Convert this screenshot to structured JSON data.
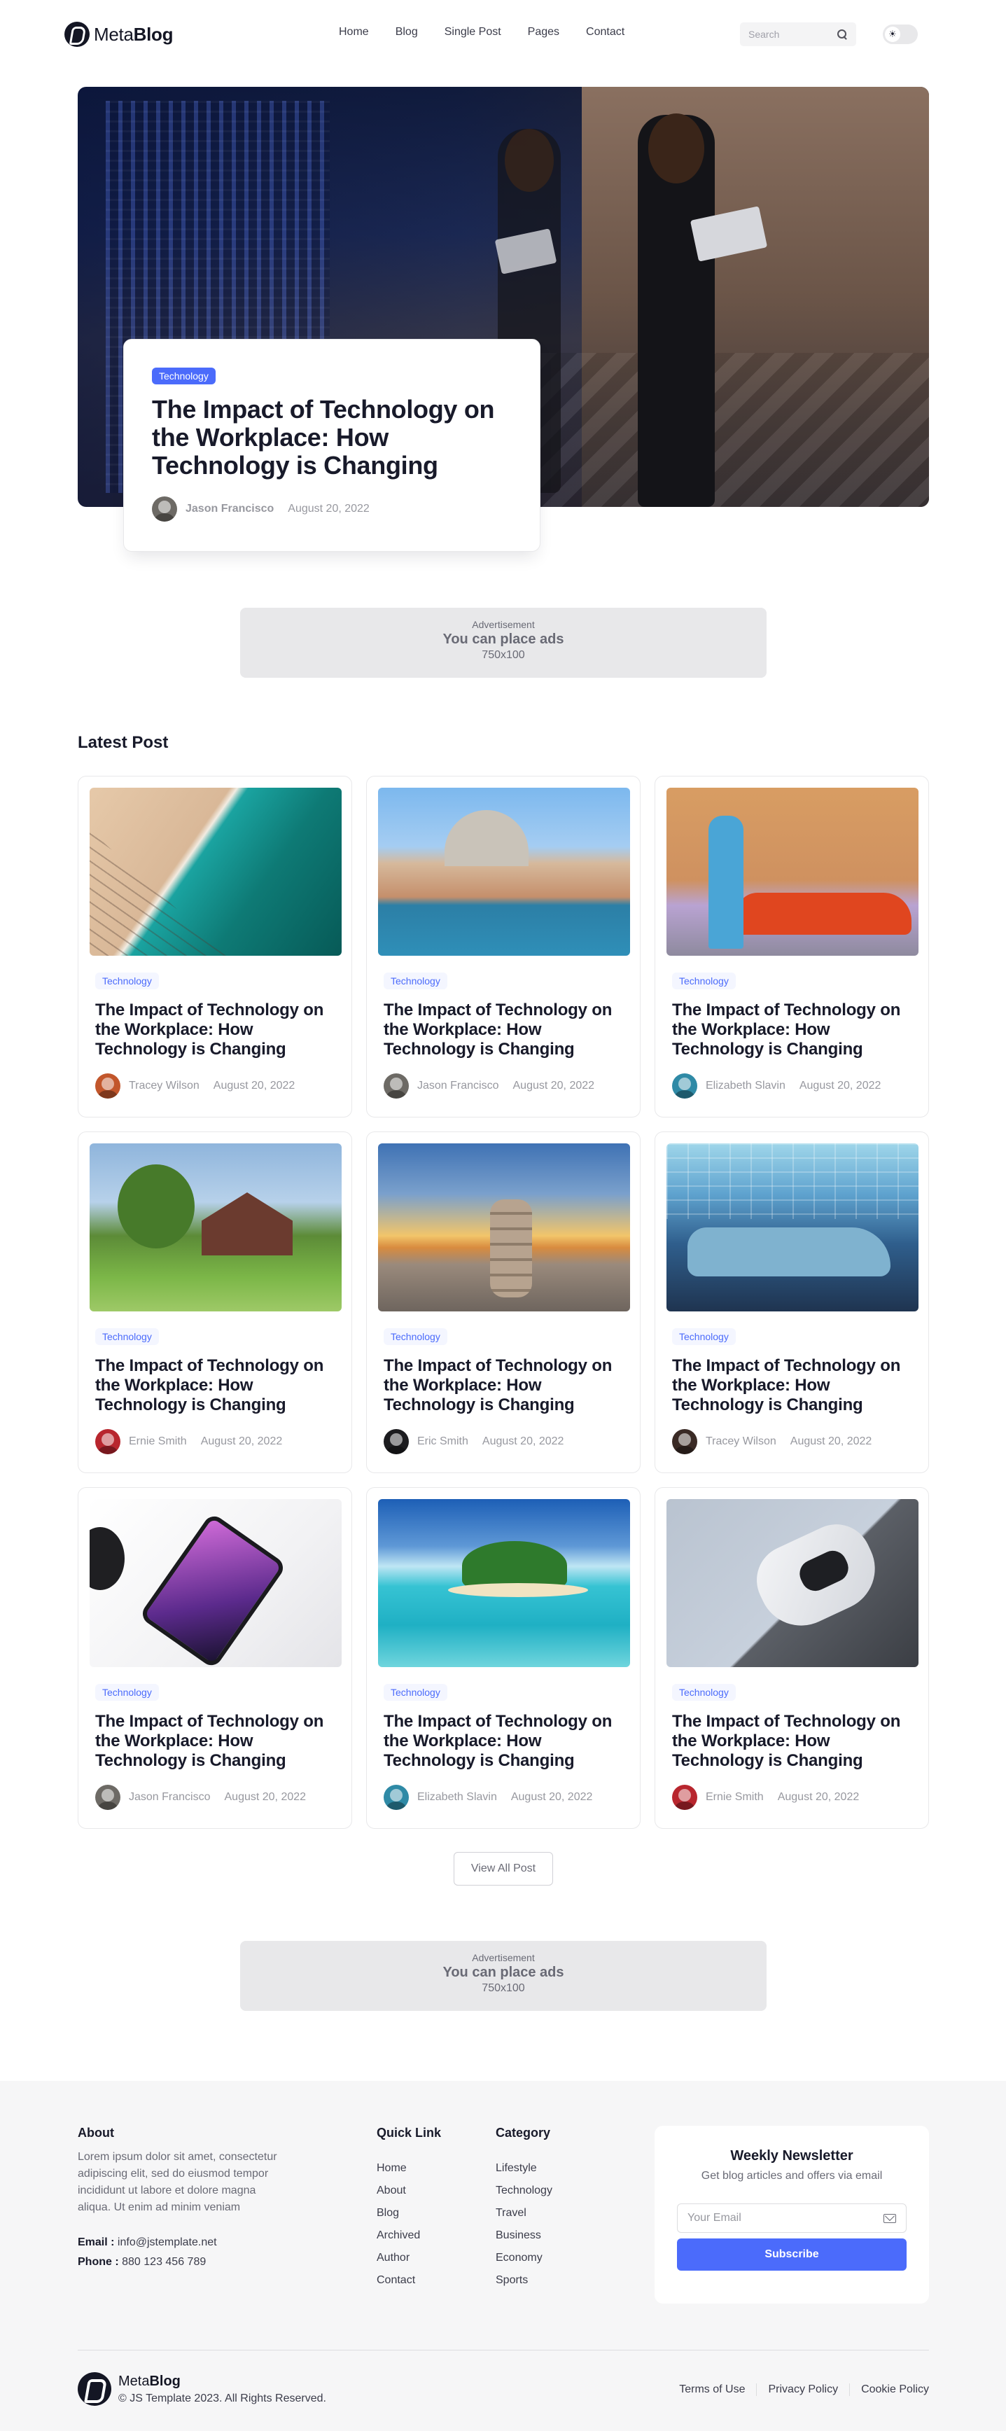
{
  "brand": {
    "name_light": "Meta",
    "name_bold": "Blog"
  },
  "nav": {
    "items": [
      "Home",
      "Blog",
      "Single Post",
      "Pages",
      "Contact"
    ]
  },
  "search": {
    "placeholder": "Search"
  },
  "theme_toggle": {
    "icon": "sun-icon",
    "glyph": "☀",
    "state": "light"
  },
  "hero": {
    "badge": "Technology",
    "title": "The Impact of Technology on the Workplace: How Technology is Changing",
    "author": "Jason Francisco",
    "date": "August 20, 2022"
  },
  "ads": [
    {
      "label": "Advertisement",
      "text": "You can place ads",
      "size": "750x100"
    },
    {
      "label": "Advertisement",
      "text": "You can place ads",
      "size": "750x100"
    }
  ],
  "latest": {
    "title": "Latest Post",
    "posts": [
      {
        "badge": "Technology",
        "title": "The Impact of Technology on the Workplace: How Technology is Changing",
        "author": "Tracey Wilson",
        "date": "August 20, 2022",
        "image": "beach-aerial",
        "avatar_color": "#c2562b"
      },
      {
        "badge": "Technology",
        "title": "The Impact of Technology on the Workplace: How Technology is Changing",
        "author": "Jason Francisco",
        "date": "August 20, 2022",
        "image": "venice-canal",
        "avatar_color": "#6d6a65"
      },
      {
        "badge": "Technology",
        "title": "The Impact of Technology on the Workplace: How Technology is Changing",
        "author": "Elizabeth Slavin",
        "date": "August 20, 2022",
        "image": "woman-red-car",
        "avatar_color": "#2f8aa6"
      },
      {
        "badge": "Technology",
        "title": "The Impact of Technology on the Workplace: How Technology is Changing",
        "author": "Ernie Smith",
        "date": "August 20, 2022",
        "image": "country-house",
        "avatar_color": "#b8262e"
      },
      {
        "badge": "Technology",
        "title": "The Impact of Technology on the Workplace: How Technology is Changing",
        "author": "Eric Smith",
        "date": "August 20, 2022",
        "image": "stacked-rocks-sunset",
        "avatar_color": "#1c1c1f"
      },
      {
        "badge": "Technology",
        "title": "The Impact of Technology on the Workplace: How Technology is Changing",
        "author": "Tracey Wilson",
        "date": "August 20, 2022",
        "image": "classic-blue-car",
        "avatar_color": "#3a2a25"
      },
      {
        "badge": "Technology",
        "title": "The Impact of Technology on the Workplace: How Technology is Changing",
        "author": "Jason Francisco",
        "date": "August 20, 2022",
        "image": "phone-desk",
        "avatar_color": "#6d6a65"
      },
      {
        "badge": "Technology",
        "title": "The Impact of Technology on the Workplace: How Technology is Changing",
        "author": "Elizabeth Slavin",
        "date": "August 20, 2022",
        "image": "tropical-island",
        "avatar_color": "#2f8aa6"
      },
      {
        "badge": "Technology",
        "title": "The Impact of Technology on the Workplace: How Technology is Changing",
        "author": "Ernie Smith",
        "date": "August 20, 2022",
        "image": "game-controller",
        "avatar_color": "#b8262e"
      }
    ],
    "view_all": "View All Post"
  },
  "footer": {
    "about": {
      "title": "About",
      "text": "Lorem ipsum dolor sit amet, consectetur adipiscing elit, sed do eiusmod tempor incididunt ut labore et dolore magna aliqua. Ut enim ad minim veniam",
      "email_label": "Email :",
      "email": "info@jstemplate.net",
      "phone_label": "Phone :",
      "phone": "880 123 456 789"
    },
    "quick_link": {
      "title": "Quick Link",
      "items": [
        "Home",
        "About",
        "Blog",
        "Archived",
        "Author",
        "Contact"
      ]
    },
    "category": {
      "title": "Category",
      "items": [
        "Lifestyle",
        "Technology",
        "Travel",
        "Business",
        "Economy",
        "Sports"
      ]
    },
    "newsletter": {
      "title": "Weekly Newsletter",
      "subtitle": "Get blog articles and offers via email",
      "placeholder": "Your Email",
      "button": "Subscribe"
    },
    "copyright": "© JS Template 2023. All Rights Reserved.",
    "legal_links": [
      "Terms of Use",
      "Privacy Policy",
      "Cookie Policy"
    ]
  },
  "colors": {
    "accent": "#4b6bfb",
    "text": "#181a2a",
    "muted": "#97989f",
    "footer_bg": "#f6f6f7"
  }
}
